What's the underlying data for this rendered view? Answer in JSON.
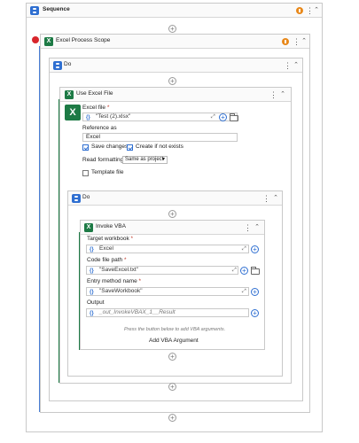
{
  "sequence": {
    "title": "Sequence"
  },
  "scope": {
    "title": "Excel Process Scope"
  },
  "do_outer": {
    "title": "Do"
  },
  "use_excel": {
    "title": "Use Excel File",
    "excel_file_label": "Excel file",
    "excel_file_value": "\"Test (2).xlsx\"",
    "reference_label": "Reference as",
    "reference_value": "Excel",
    "save_changes": "Save changes",
    "create_if_not_exists": "Create if not exists",
    "read_formatting_label": "Read formatting",
    "read_formatting_value": "Same as project",
    "template_file": "Template file"
  },
  "do_inner": {
    "title": "Do"
  },
  "invoke_vba": {
    "title": "Invoke VBA",
    "target_workbook_label": "Target workbook",
    "target_workbook_value": "Excel",
    "code_file_label": "Code file path",
    "code_file_value": "\"SaveExcel.txt\"",
    "entry_method_label": "Entry method name",
    "entry_method_value": "\"SaveWorkbook\"",
    "output_label": "Output",
    "output_value": "_out_InvokeVBAX_1__Result",
    "hint": "Press the button below to add VBA arguments.",
    "add_argument": "Add VBA Argument"
  },
  "icons": {
    "required_mark": "*",
    "brace": "{}",
    "kebab": "⋮",
    "collapse": "⌃",
    "plus": "+",
    "expand": "⤢",
    "dropdown": "▾",
    "excel_letter": "X"
  }
}
